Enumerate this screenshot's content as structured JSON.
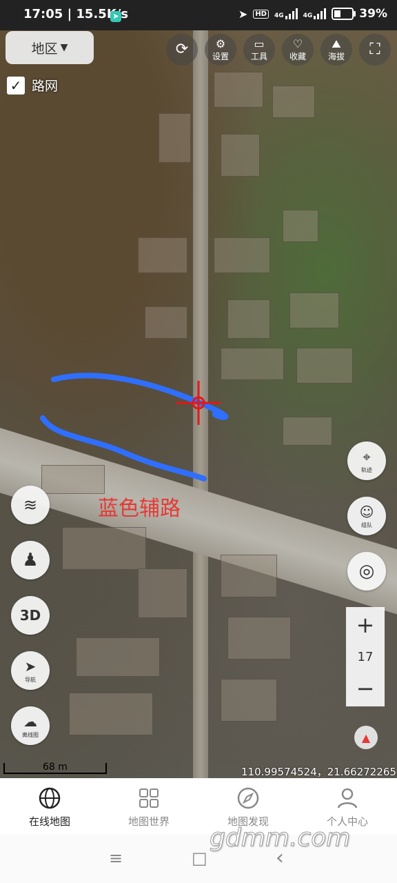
{
  "status_bar": {
    "time": "17:05 | 15.5K/s",
    "hd": "HD",
    "net1": "4G",
    "net2": "4G",
    "battery": "39%"
  },
  "top": {
    "region_label": "地区",
    "road_checkbox_label": "路网",
    "buttons": [
      {
        "label": "",
        "icon": "search-icon"
      },
      {
        "label": "设置",
        "icon": "gear-icon"
      },
      {
        "label": "工具",
        "icon": "toolbox-icon"
      },
      {
        "label": "收藏",
        "icon": "heart-icon"
      },
      {
        "label": "海拔",
        "icon": "mountain-icon"
      },
      {
        "label": "",
        "icon": "fullscreen-icon"
      }
    ]
  },
  "annotation": {
    "text": "蓝色辅路",
    "color": "#e53935",
    "line_color": "#2f6fff"
  },
  "left_controls": [
    {
      "label": "",
      "icon": "layers-icon"
    },
    {
      "label": "",
      "icon": "streetview-person-icon"
    },
    {
      "label": "3D",
      "icon": "3d-icon"
    },
    {
      "label": "导航",
      "icon": "navigate-icon"
    },
    {
      "label": "离线图",
      "icon": "offline-download-icon"
    }
  ],
  "right_controls": [
    {
      "label": "轨迹",
      "icon": "track-icon"
    },
    {
      "label": "组队",
      "icon": "team-icon"
    },
    {
      "label": "",
      "icon": "locate-icon"
    }
  ],
  "zoom": {
    "plus": "+",
    "level": "17",
    "minus": "−"
  },
  "scale_label": "68 m",
  "coordinates": "110.99574524，21.66272265",
  "bottom_nav": [
    {
      "label": "在线地图",
      "icon": "globe-icon",
      "active": true
    },
    {
      "label": "地图世界",
      "icon": "grid-icon",
      "active": false
    },
    {
      "label": "地图发现",
      "icon": "compass-discover-icon",
      "active": false
    },
    {
      "label": "个人中心",
      "icon": "person-icon",
      "active": false
    }
  ],
  "watermark": "gdmm.com",
  "system_nav": [
    "≡",
    "□",
    "‹"
  ]
}
